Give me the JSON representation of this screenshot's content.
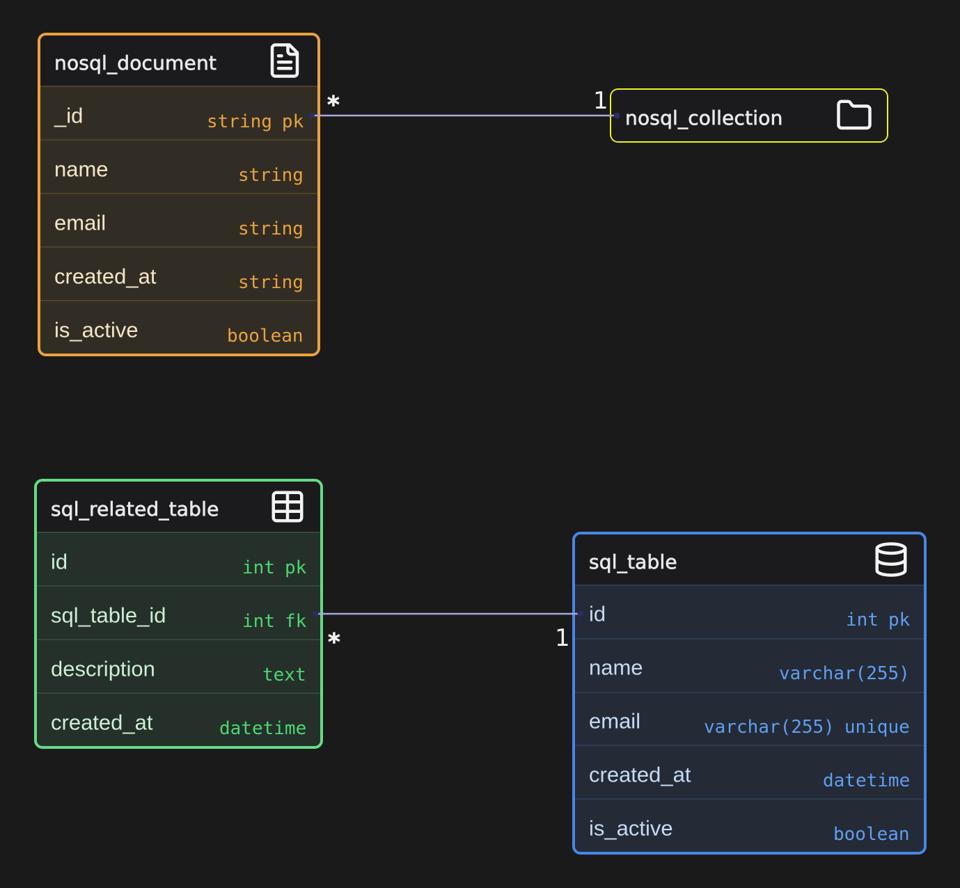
{
  "canvas": {
    "background": "#1a1a1a"
  },
  "diagram": {
    "tables": [
      {
        "name": "nosql_document",
        "icon": "file-text-icon",
        "accent": "#eda13f",
        "collapsed": false,
        "fields": [
          {
            "name": "_id",
            "type": "string",
            "constraint": "pk"
          },
          {
            "name": "name",
            "type": "string",
            "constraint": ""
          },
          {
            "name": "email",
            "type": "string",
            "constraint": ""
          },
          {
            "name": "created_at",
            "type": "string",
            "constraint": ""
          },
          {
            "name": "is_active",
            "type": "boolean",
            "constraint": ""
          }
        ]
      },
      {
        "name": "nosql_collection",
        "icon": "folder-icon",
        "accent": "#eff21c",
        "collapsed": true,
        "fields": []
      },
      {
        "name": "sql_related_table",
        "icon": "table-icon",
        "accent": "#65db85",
        "collapsed": false,
        "fields": [
          {
            "name": "id",
            "type": "int",
            "constraint": "pk"
          },
          {
            "name": "sql_table_id",
            "type": "int",
            "constraint": "fk"
          },
          {
            "name": "description",
            "type": "text",
            "constraint": ""
          },
          {
            "name": "created_at",
            "type": "datetime",
            "constraint": ""
          }
        ]
      },
      {
        "name": "sql_table",
        "icon": "database-icon",
        "accent": "#4687e7",
        "collapsed": false,
        "fields": [
          {
            "name": "id",
            "type": "int",
            "constraint": "pk"
          },
          {
            "name": "name",
            "type": "varchar(255)",
            "constraint": ""
          },
          {
            "name": "email",
            "type": "varchar(255)",
            "constraint": "unique"
          },
          {
            "name": "created_at",
            "type": "datetime",
            "constraint": ""
          },
          {
            "name": "is_active",
            "type": "boolean",
            "constraint": ""
          }
        ]
      }
    ],
    "relationships": [
      {
        "from_table": "nosql_document",
        "from_field": "_id",
        "to_table": "nosql_collection",
        "source_cardinality": "*",
        "target_cardinality": "1",
        "line_color": "#a8a7dc",
        "endpoint_color": "#2f2b64"
      },
      {
        "from_table": "sql_related_table",
        "from_field": "sql_table_id",
        "to_table": "sql_table",
        "to_field": "id",
        "source_cardinality": "*",
        "target_cardinality": "1",
        "line_color": "#a8a7dc",
        "endpoint_color": "#2f2b64"
      }
    ]
  }
}
